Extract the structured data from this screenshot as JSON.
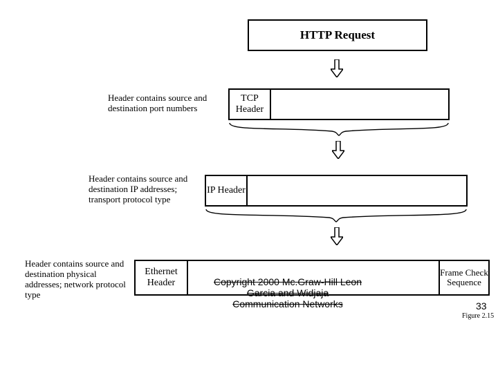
{
  "title": "HTTP Request",
  "rows": {
    "tcp": {
      "caption": "Header contains source and destination port numbers",
      "header": "TCP Header"
    },
    "ip": {
      "caption": "Header contains source and destination IP addresses; transport protocol type",
      "header": "IP Header"
    },
    "eth": {
      "caption": "Header contains source and destination physical addresses; network protocol type",
      "header": "Ethernet Header",
      "fcs": "Frame Check Sequence"
    }
  },
  "footer": {
    "line1": "Copyright 2000 Mc.Graw-Hill Leon",
    "line2": "Garcia and Widjaja",
    "line3": "Communication Networks"
  },
  "slide_number": "33",
  "figure_ref": "Figure 2.15"
}
